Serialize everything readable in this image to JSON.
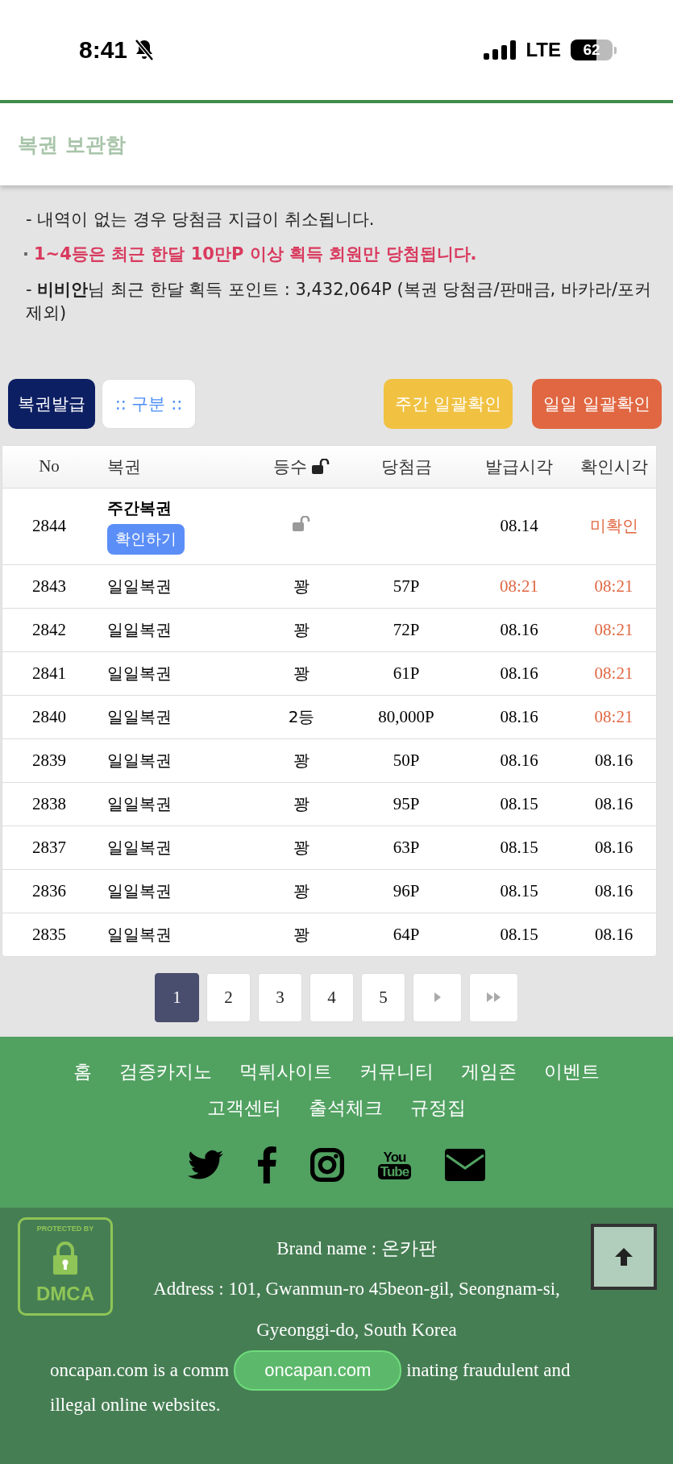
{
  "status_bar": {
    "time": "8:41",
    "network": "LTE",
    "battery": "62"
  },
  "header": {
    "title": "복권 보관함"
  },
  "notices": [
    {
      "kind": "plain",
      "text": "- 내역이 없는 경우 당첨금 지급이 취소됩니다."
    },
    {
      "kind": "alert",
      "bullet": "·",
      "text": "1~4등은 최근 한달 10만P 이상 획득 회원만 당첨됩니다."
    },
    {
      "kind": "plain",
      "text": "- **비비안**님 최근 한달 획득 포인트 : 3,432,064P (복권 당첨금/판매금, 바카라/포커 제외)"
    }
  ],
  "toolbar": {
    "issue_button": "복권발급",
    "filter": ":: 구분 ::",
    "weekly_button": "주간 일괄확인",
    "daily_button": "일일 일괄확인"
  },
  "table": {
    "columns": [
      "No",
      "복권",
      "등수",
      "당첨금",
      "발급시각",
      "확인시각"
    ],
    "rows": [
      {
        "kind": "weekly",
        "no": "2844",
        "ticket": "주간복권",
        "action": "확인하기",
        "rank": "",
        "prize": "",
        "issued": "08.14",
        "issued_recent": false,
        "confirmed": "미확인",
        "confirmed_recent": true
      },
      {
        "kind": "daily",
        "no": "2843",
        "ticket": "일일복권",
        "rank": "꽝",
        "prize": "57P",
        "issued": "08:21",
        "issued_recent": true,
        "confirmed": "08:21",
        "confirmed_recent": true
      },
      {
        "kind": "daily",
        "no": "2842",
        "ticket": "일일복권",
        "rank": "꽝",
        "prize": "72P",
        "issued": "08.16",
        "issued_recent": false,
        "confirmed": "08:21",
        "confirmed_recent": true
      },
      {
        "kind": "daily",
        "no": "2841",
        "ticket": "일일복권",
        "rank": "꽝",
        "prize": "61P",
        "issued": "08.16",
        "issued_recent": false,
        "confirmed": "08:21",
        "confirmed_recent": true
      },
      {
        "kind": "daily",
        "no": "2840",
        "ticket": "일일복권",
        "rank": "2등",
        "prize": "80,000P",
        "issued": "08.16",
        "issued_recent": false,
        "confirmed": "08:21",
        "confirmed_recent": true
      },
      {
        "kind": "daily",
        "no": "2839",
        "ticket": "일일복권",
        "rank": "꽝",
        "prize": "50P",
        "issued": "08.16",
        "issued_recent": false,
        "confirmed": "08.16",
        "confirmed_recent": false
      },
      {
        "kind": "daily",
        "no": "2838",
        "ticket": "일일복권",
        "rank": "꽝",
        "prize": "95P",
        "issued": "08.15",
        "issued_recent": false,
        "confirmed": "08.16",
        "confirmed_recent": false
      },
      {
        "kind": "daily",
        "no": "2837",
        "ticket": "일일복권",
        "rank": "꽝",
        "prize": "63P",
        "issued": "08.15",
        "issued_recent": false,
        "confirmed": "08.16",
        "confirmed_recent": false
      },
      {
        "kind": "daily",
        "no": "2836",
        "ticket": "일일복권",
        "rank": "꽝",
        "prize": "96P",
        "issued": "08.15",
        "issued_recent": false,
        "confirmed": "08.16",
        "confirmed_recent": false
      },
      {
        "kind": "daily",
        "no": "2835",
        "ticket": "일일복권",
        "rank": "꽝",
        "prize": "64P",
        "issued": "08.15",
        "issued_recent": false,
        "confirmed": "08.16",
        "confirmed_recent": false
      }
    ]
  },
  "pagination": {
    "pages": [
      {
        "label": "1",
        "selected": true
      },
      {
        "label": "2",
        "selected": false
      },
      {
        "label": "3",
        "selected": false
      },
      {
        "label": "4",
        "selected": false
      },
      {
        "label": "5",
        "selected": false
      }
    ]
  },
  "footer_menu": [
    [
      "홈",
      "검증카지노",
      "먹튀사이트",
      "커뮤니티",
      "게임존",
      "이벤트"
    ],
    [
      "고객센터",
      "출석체크",
      "규정집"
    ]
  ],
  "social": [
    {
      "kind": "twitter"
    },
    {
      "kind": "facebook"
    },
    {
      "kind": "instagram"
    },
    {
      "kind": "youtube",
      "top": "You",
      "bottom": "Tube"
    },
    {
      "kind": "mail"
    }
  ],
  "company": {
    "badge_top": "PROTECTED BY",
    "badge_bottom": "DMCA",
    "brand": "Brand name : 온카판",
    "address": "Address : 101, Gwanmun-ro 45beon-gil, Seongnam-si, Gyeonggi-do, South Korea",
    "about_start": "oncapan.com is a comm",
    "about_end": "inating fraudulent and",
    "about_last": "illegal online websites."
  },
  "browser_url": "oncapan.com"
}
